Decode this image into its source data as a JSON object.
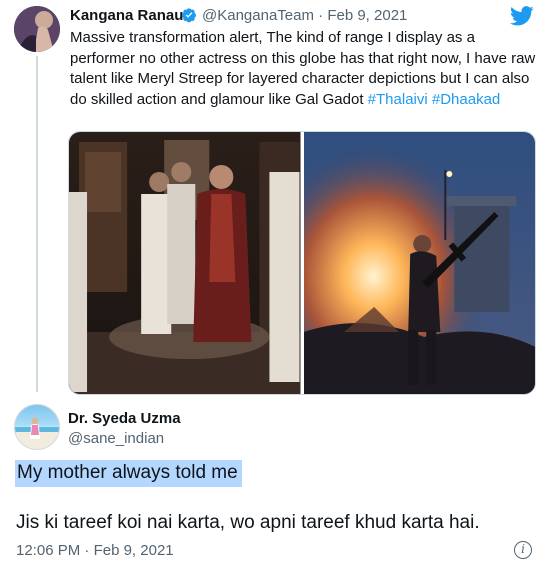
{
  "quoted_tweet": {
    "author_name": "Kangana Ranaut",
    "handle": "@KanganaTeam",
    "separator": "·",
    "date": "Feb 9, 2021",
    "verified": true,
    "text": "Massive transformation alert, The kind of range I display as a performer no other actress on this globe has that right now, I have raw talent like Meryl Streep for layered character depictions but I can also do skilled action and glamour like Gal Gadot",
    "hashtags": [
      "#Thalaivi",
      "#Dhaakad"
    ],
    "media": [
      {
        "icon": "photo-thalaivi-scene"
      },
      {
        "icon": "photo-dhaakad-action"
      }
    ]
  },
  "reply": {
    "author_name": "Dr. Syeda Uzma",
    "handle": "@sane_indian",
    "line1": "My mother always told me",
    "line2": "Jis ki tareef koi nai karta, wo apni tareef khud karta hai.",
    "time": "12:06 PM",
    "separator": "·",
    "date": "Feb 9, 2021"
  },
  "colors": {
    "accent": "#1d9bf0",
    "text": "#0f1419",
    "muted": "#536471",
    "highlight": "#b4d7ff"
  },
  "icons": [
    "twitter-bird-icon",
    "verified-badge-icon",
    "info-icon"
  ]
}
